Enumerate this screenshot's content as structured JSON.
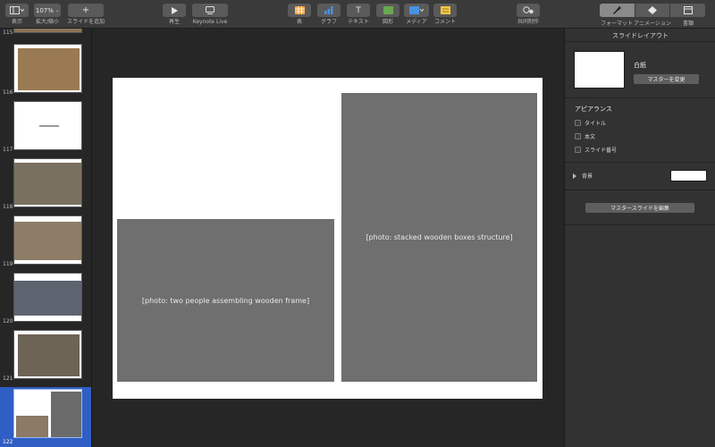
{
  "toolbar": {
    "view_label": "表示",
    "zoom_value": "107%",
    "zoom_label": "拡大/縮小",
    "add_slide_label": "スライドを追加",
    "play_label": "再生",
    "keynote_live_label": "Keynote Live",
    "table_label": "表",
    "chart_label": "グラフ",
    "text_label": "テキスト",
    "shape_label": "図形",
    "media_label": "メディア",
    "comment_label": "コメント",
    "collaborate_label": "共同制作",
    "format_label": "フォーマット",
    "animate_label": "アニメーション",
    "document_label": "書類",
    "accent_color": "#3b82f6"
  },
  "navigator": {
    "slides": [
      {
        "number": "115"
      },
      {
        "number": "116"
      },
      {
        "number": "117"
      },
      {
        "number": "118"
      },
      {
        "number": "119"
      },
      {
        "number": "120"
      },
      {
        "number": "121"
      },
      {
        "number": "122",
        "selected": true
      }
    ],
    "selection_color": "#2f5ec4"
  },
  "slide": {
    "left_photo": "[photo: two people assembling wooden frame]",
    "right_photo": "[photo: stacked wooden boxes structure]"
  },
  "inspector": {
    "title": "スライドレイアウト",
    "master_name": "白紙",
    "change_master_label": "マスターを変更",
    "appearance_title": "アピアランス",
    "check_title": "タイトル",
    "check_body": "本文",
    "check_slide_number": "スライド番号",
    "background_label": "背景",
    "background_color": "#ffffff",
    "edit_master_label": "マスタースライドを編集"
  }
}
